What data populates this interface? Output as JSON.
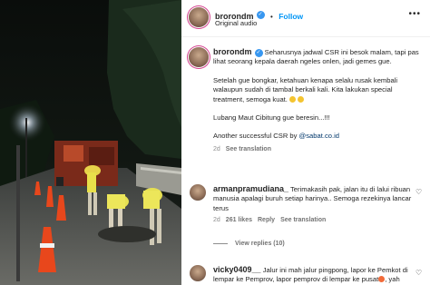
{
  "post": {
    "username": "brorondm",
    "follow_label": "Follow",
    "audio": "Original audio",
    "verified_glyph": "✓",
    "caption_p1": "Seharusnya jadwal CSR ini besok malam, tapi pas lihat seorang kepala daerah ngeles onlen, jadi gemes gue.",
    "caption_p2": "Setelah gue bongkar, ketahuan kenapa selalu rusak kembali walaupun sudah di tambal berkali kali. Kita lakukan special treatment, semoga kuat.",
    "caption_p3": "Lubang Maut Cibitung gue beresin...!!!",
    "caption_p4_pre": "Another successful CSR by ",
    "caption_p4_link": "@sabat.co.id",
    "time": "2d",
    "see_translation": "See translation"
  },
  "comments": [
    {
      "username": "armanpramudiana_",
      "text": "Terimakasih pak, jalan itu di lalui ribuan manusia apalagi buruh setiap harinya.. Semoga rezekinya lancar terus",
      "time": "2d",
      "likes": "261 likes",
      "reply": "Reply",
      "see_translation": "See translation",
      "view_replies": "View replies (10)"
    },
    {
      "username": "vicky0409__",
      "text": "Jalur ini mah jalur pingpong, lapor ke Pemkot di lempar ke Pemprov, lapor pemprov di lempar ke pusat",
      "text_tail": ", yah"
    }
  ],
  "icons": {
    "more": "more-options-icon",
    "heart": "heart-icon",
    "verified": "verified-badge-icon"
  },
  "colors": {
    "follow": "#0095f6",
    "verified": "#3897f0",
    "muted": "#737373",
    "link": "#00376b"
  }
}
